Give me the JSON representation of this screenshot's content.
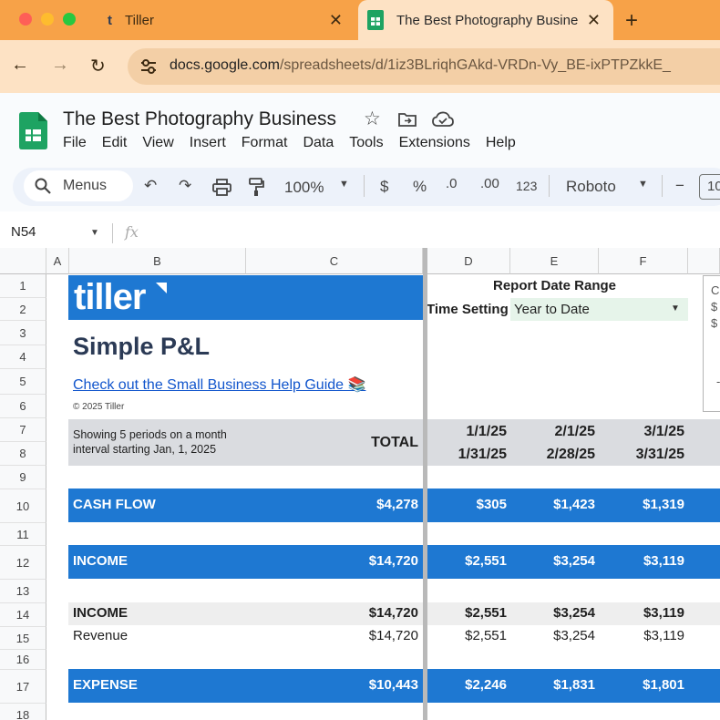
{
  "browser": {
    "tabs": [
      {
        "title": "Tiller"
      },
      {
        "title": "The Best Photography Busine"
      }
    ],
    "url_prefix": "docs.google.com",
    "url_path": "/spreadsheets/d/1iz3BLriqhGAkd-VRDn-Vy_BE-ixPTPZkkE_",
    "new_tab": "+",
    "close": "✕"
  },
  "doc": {
    "title": "The Best Photography Business",
    "menu": [
      "File",
      "Edit",
      "View",
      "Insert",
      "Format",
      "Data",
      "Tools",
      "Extensions",
      "Help"
    ]
  },
  "toolbar": {
    "menus_label": "Menus",
    "zoom": "100%",
    "currency": "$",
    "percent": "%",
    "dec_decrease": ".0",
    "dec_increase": ".00",
    "more_formats": "123",
    "font": "Roboto",
    "minus": "−",
    "font_size": "10"
  },
  "formula_bar": {
    "cell_ref": "N54",
    "fx": "fx"
  },
  "columns": [
    "A",
    "B",
    "C",
    "D",
    "E",
    "F"
  ],
  "rows": [
    "1",
    "2",
    "3",
    "4",
    "5",
    "6",
    "7",
    "8",
    "9",
    "10",
    "11",
    "12",
    "13",
    "14",
    "15",
    "16",
    "17",
    "18"
  ],
  "sheet": {
    "logo_text": "tiller",
    "heading": "Simple P&L",
    "help_link": "Check out the Small Business Help Guide 📚",
    "copyright": "© 2025 Tiller",
    "report_range_label": "Report Date Range",
    "time_setting_label": "Time Setting",
    "time_setting_value": "Year to Date",
    "periods_note_1": "Showing 5 periods on a month",
    "periods_note_2": "interval starting Jan, 1, 2025",
    "total_label": "TOTAL",
    "periods": [
      {
        "start": "1/1/25",
        "end": "1/31/25"
      },
      {
        "start": "2/1/25",
        "end": "2/28/25"
      },
      {
        "start": "3/1/25",
        "end": "3/31/25"
      }
    ],
    "side_box_lines": [
      "C",
      "$",
      "$"
    ],
    "side_box_dash": "-",
    "rows": {
      "cash_flow": {
        "label": "CASH FLOW",
        "total": "$4,278",
        "values": [
          "$305",
          "$1,423",
          "$1,319"
        ]
      },
      "income_band": {
        "label": "INCOME",
        "total": "$14,720",
        "values": [
          "$2,551",
          "$3,254",
          "$3,119"
        ]
      },
      "income_sub": {
        "label": "INCOME",
        "total": "$14,720",
        "values": [
          "$2,551",
          "$3,254",
          "$3,119"
        ]
      },
      "revenue": {
        "label": "Revenue",
        "total": "$14,720",
        "values": [
          "$2,551",
          "$3,254",
          "$3,119"
        ]
      },
      "expense": {
        "label": "EXPENSE",
        "total": "$10,443",
        "values": [
          "$2,246",
          "$1,831",
          "$1,801"
        ]
      }
    }
  }
}
